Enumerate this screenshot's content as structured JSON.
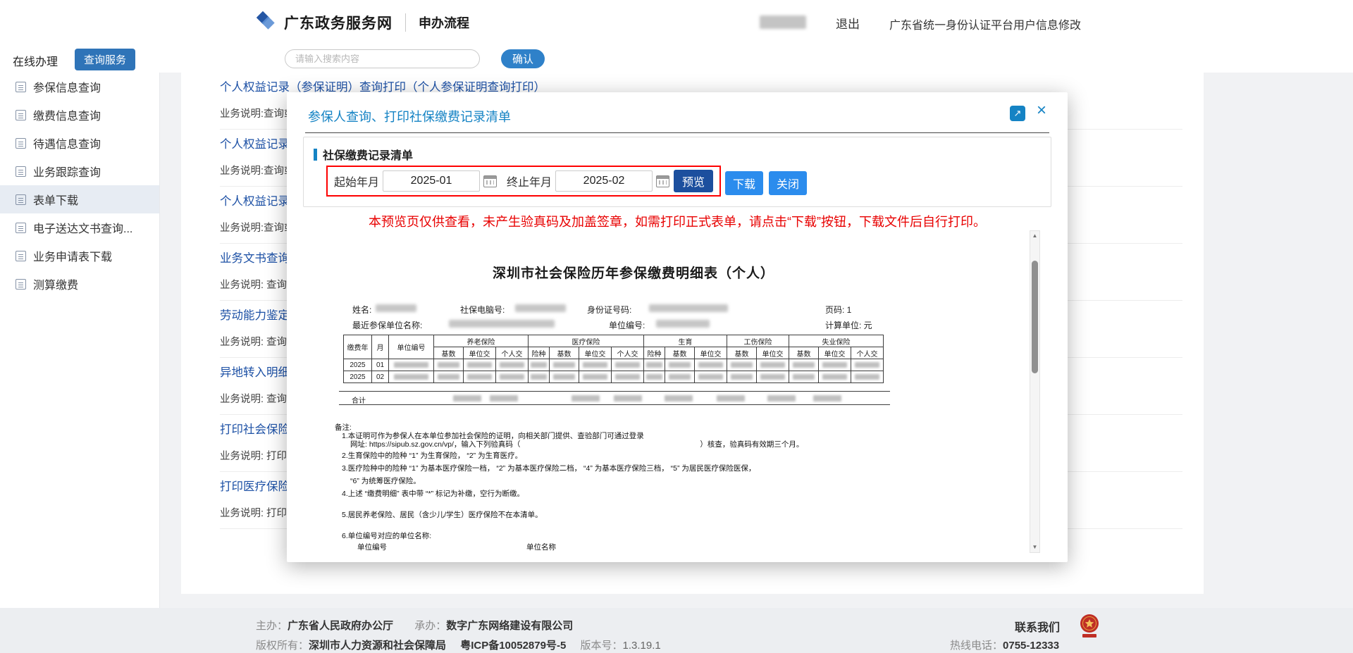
{
  "header": {
    "brand": "广东政务服务网",
    "section": "申办流程",
    "logout": "退出",
    "account_link": "广东省统一身份认证平台用户信息修改"
  },
  "nav": {
    "online_tab": "在线办理",
    "query_tab": "查询服务",
    "search_placeholder": "请输入搜索内容",
    "confirm": "确认"
  },
  "sidebar": [
    "参保信息查询",
    "缴费信息查询",
    "待遇信息查询",
    "业务跟踪查询",
    "表单下载",
    "电子送达文书查询...",
    "业务申请表下载",
    "测算缴费"
  ],
  "services": [
    {
      "title": "个人权益记录（参保证明）查询打印（个人参保证明查询打印）",
      "desc": "业务说明:查询或"
    },
    {
      "title": "个人权益记录",
      "desc": "业务说明:查询或"
    },
    {
      "title": "个人权益记录",
      "desc": "业务说明:查询或"
    },
    {
      "title": "业务文书查询打",
      "desc": "业务说明: 查询"
    },
    {
      "title": "劳动能力鉴定回",
      "desc": "业务说明: 查询"
    },
    {
      "title": "异地转入明细查",
      "desc": "业务说明: 查询"
    },
    {
      "title": "打印社会保险未",
      "desc": "业务说明: 打印社"
    },
    {
      "title": "打印医疗保险未",
      "desc": "业务说明: 打印医"
    }
  ],
  "modal": {
    "title": "参保人查询、打印社保缴费记录清单",
    "section_title": "社保缴费记录清单",
    "start_label": "起始年月",
    "start_value": "2025-01",
    "end_label": "终止年月",
    "end_value": "2025-02",
    "preview_btn": "预览",
    "download_btn": "下载",
    "close_btn": "关闭",
    "warning": "本预览页仅供查看，未产生验真码及加盖签章，如需打印正式表单，请点击“下载”按钮，下载文件后自行打印。"
  },
  "doc": {
    "title": "深圳市社会保险历年参保缴费明细表（个人）",
    "labels": {
      "name": "姓名:",
      "computer_no": "社保电脑号:",
      "id_no": "身份证号码:",
      "page": "页码: 1",
      "recent_unit": "最近参保单位名称:",
      "unit_no": "单位编号:",
      "calc_unit": "计算单位: 元"
    },
    "table": {
      "col_year": "缴费年",
      "col_month": "月",
      "col_unit": "单位编号",
      "groups": [
        {
          "name": "养老保险",
          "cols": [
            "基数",
            "单位交",
            "个人交"
          ]
        },
        {
          "name": "医疗保险",
          "cols": [
            "险种",
            "基数",
            "单位交",
            "个人交"
          ]
        },
        {
          "name": "生育",
          "cols": [
            "险种",
            "基数",
            "单位交"
          ]
        },
        {
          "name": "工伤保险",
          "cols": [
            "基数",
            "单位交"
          ]
        },
        {
          "name": "失业保险",
          "cols": [
            "基数",
            "单位交",
            "个人交"
          ]
        }
      ],
      "rows": [
        {
          "year": "2025",
          "month": "01"
        },
        {
          "year": "2025",
          "month": "02"
        }
      ],
      "total_label": "合计"
    },
    "notes": {
      "head": "备注:",
      "n1a": "1.本证明可作为参保人在本单位参加社会保险的证明，向相关部门提供、查验部门可通过登录",
      "n1b": "网址: https://sipub.sz.gov.cn/vp/，输入下列验真码（",
      "n1c": "）核查，验真码有效期三个月。",
      "n2": "2.生育保险中的险种 “1” 为生育保险， “2” 为生育医疗。",
      "n3a": "3.医疗险种中的险种 “1” 为基本医疗保险一档， “2” 为基本医疗保险二档， “4” 为基本医疗保险三档， “5” 为居民医疗保险医保，",
      "n3b": "“6” 为统筹医疗保险。",
      "n4": "4.上述 “缴费明细” 表中带 “*” 标记为补缴，空行为断缴。",
      "n5": "5.居民养老保险、居民（含少儿/学生）医疗保险不在本清单。",
      "n6": "6.单位编号对应的单位名称:",
      "unit_no_col": "单位编号",
      "unit_name_col": "单位名称"
    }
  },
  "footer": {
    "host_label": "主办：",
    "host": "广东省人民政府办公厅",
    "undertake_label": "承办：",
    "undertake": "数字广东网络建设有限公司",
    "copyright_label": "版权所有：",
    "copyright": "深圳市人力资源和社会保障局",
    "icp": "粤ICP备10052879号-5",
    "version_label": "版本号：",
    "version": "1.3.19.1",
    "contact": "联系我们",
    "hotline_label": "热线电话：",
    "hotline": "0755-12333"
  }
}
